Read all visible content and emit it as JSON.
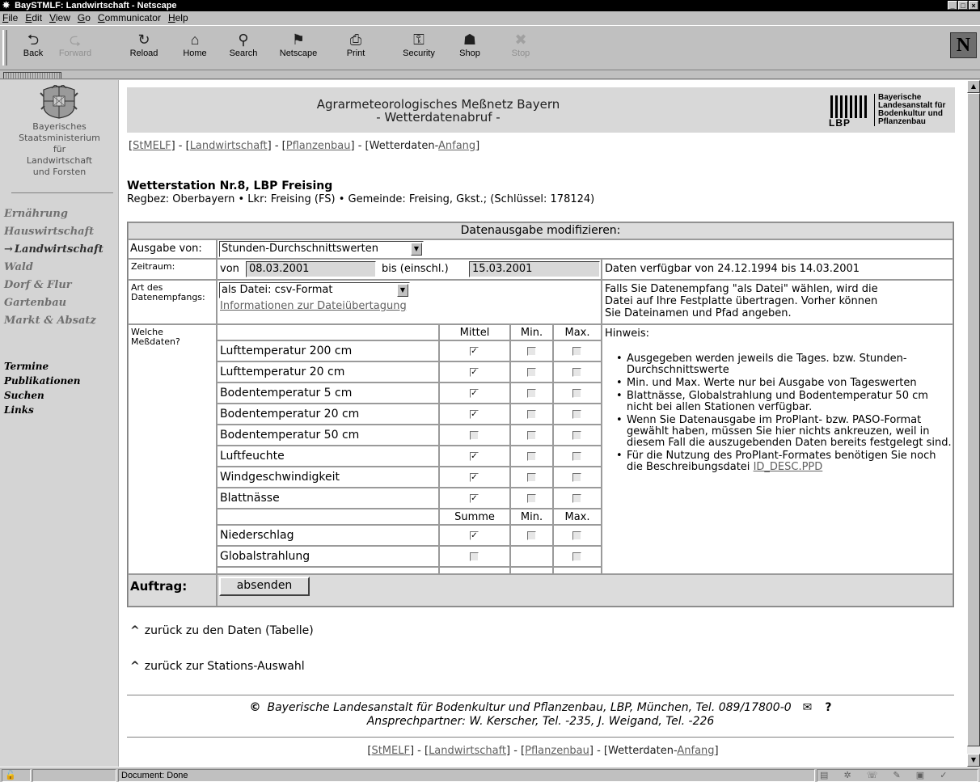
{
  "window": {
    "title": "BaySTMLF: Landwirtschaft - Netscape",
    "controls": [
      "_",
      "□",
      "×"
    ]
  },
  "menu": [
    "File",
    "Edit",
    "View",
    "Go",
    "Communicator",
    "Help"
  ],
  "toolbar": [
    {
      "label": "Back",
      "icon": "back-arrow-icon",
      "glyph": "⮌",
      "enabled": true
    },
    {
      "label": "Forward",
      "icon": "forward-arrow-icon",
      "glyph": "⮎",
      "enabled": false
    },
    {
      "label": "Reload",
      "icon": "reload-icon",
      "glyph": "↻",
      "enabled": true
    },
    {
      "label": "Home",
      "icon": "home-icon",
      "glyph": "⌂",
      "enabled": true
    },
    {
      "label": "Search",
      "icon": "search-icon",
      "glyph": "⚲",
      "enabled": true
    },
    {
      "label": "Netscape",
      "icon": "netscape-icon",
      "glyph": "⚑",
      "enabled": true
    },
    {
      "label": "Print",
      "icon": "print-icon",
      "glyph": "⎙",
      "enabled": true
    },
    {
      "label": "Security",
      "icon": "security-lock-icon",
      "glyph": "⚿",
      "enabled": true
    },
    {
      "label": "Shop",
      "icon": "shop-icon",
      "glyph": "☗",
      "enabled": true
    },
    {
      "label": "Stop",
      "icon": "stop-icon",
      "glyph": "✖",
      "enabled": false
    }
  ],
  "brand_logo": "N",
  "sidebar": {
    "ministry": "Bayerisches\nStaatsministerium\nfür\nLandwirtschaft\nund Forsten",
    "nav": [
      {
        "label": "Ernährung",
        "active": false
      },
      {
        "label": "Hauswirtschaft",
        "active": false
      },
      {
        "label": "Landwirtschaft",
        "active": true
      },
      {
        "label": "Wald",
        "active": false
      },
      {
        "label": "Dorf & Flur",
        "active": false
      },
      {
        "label": "Gartenbau",
        "active": false
      },
      {
        "label": "Markt & Absatz",
        "active": false
      }
    ],
    "nav2": [
      "Termine",
      "Publikationen",
      "Suchen",
      "Links"
    ]
  },
  "header": {
    "title1": "Agrarmeteorologisches Meßnetz Bayern",
    "title2": "- Wetterdatenabruf -",
    "lbp_abbr": "LBP",
    "lbp_name": "Bayerische\nLandesanstalt für\nBodenkultur und\nPflanzenbau"
  },
  "breadcrumb": {
    "stmelf": "StMELF",
    "landwirtschaft": "Landwirtschaft",
    "pflanzenbau": "Pflanzenbau",
    "wetter_prefix": "Wetterdaten-",
    "anfang": "Anfang"
  },
  "station": {
    "name": "Wetterstation Nr.8, LBP Freising",
    "location": "Regbez: Oberbayern • Lkr: Freising (FS) • Gemeinde: Freising, Gkst.; (Schlüssel: 178124)"
  },
  "form": {
    "heading": "Datenausgabe modifizieren:",
    "ausgabe_label": "Ausgabe von:",
    "ausgabe_value": "Stunden-Durchschnittswerten",
    "zeitraum_label": "Zeitraum:",
    "von_label": "von",
    "von_value": "08.03.2001",
    "bis_label": "bis (einschl.)",
    "bis_value": "15.03.2001",
    "verfuegbar": "Daten verfügbar von 24.12.1994 bis 14.03.2001",
    "art_label": "Art des\nDatenempfangs:",
    "art_value": "als Datei: csv-Format",
    "info_link": "Informationen zur Dateiübertagung",
    "art_hint": "Falls Sie Datenempfang \"als Datei\" wählen, wird die\nDatei auf Ihre Festplatte übertragen. Vorher können\nSie Dateinamen und Pfad angeben.",
    "welche_label": "Welche\nMeßdaten?",
    "col_mittel": "Mittel",
    "col_summe": "Summe",
    "col_min": "Min.",
    "col_max": "Max.",
    "rows": [
      {
        "name": "Lufttemperatur 200 cm",
        "a": true,
        "min": false,
        "max": false,
        "has_min": true
      },
      {
        "name": "Lufttemperatur 20 cm",
        "a": true,
        "min": false,
        "max": false,
        "has_min": true
      },
      {
        "name": "Bodentemperatur 5 cm",
        "a": true,
        "min": false,
        "max": false,
        "has_min": true
      },
      {
        "name": "Bodentemperatur 20 cm",
        "a": true,
        "min": false,
        "max": false,
        "has_min": true
      },
      {
        "name": "Bodentemperatur 50 cm",
        "a": false,
        "min": false,
        "max": false,
        "has_min": true
      },
      {
        "name": "Luftfeuchte",
        "a": true,
        "min": false,
        "max": false,
        "has_min": true
      },
      {
        "name": "Windgeschwindigkeit",
        "a": true,
        "min": false,
        "max": false,
        "has_min": true
      },
      {
        "name": "Blattnässe",
        "a": true,
        "min": false,
        "max": false,
        "has_min": true
      }
    ],
    "rows2": [
      {
        "name": "Niederschlag",
        "a": true,
        "min": false,
        "max": false,
        "has_min": true
      },
      {
        "name": "Globalstrahlung",
        "a": false,
        "min": false,
        "max": false,
        "has_min": false
      }
    ],
    "hinweis_title": "Hinweis:",
    "hinweis": [
      "Ausgegeben werden jeweils die Tages. bzw. Stunden-Durchschnittswerte",
      "Min. und Max. Werte nur bei Ausgabe von Tageswerten",
      "Blattnässe, Globalstrahlung und Bodentemperatur 50 cm nicht bei allen Stationen verfügbar.",
      "Wenn Sie Datenausgabe im ProPlant- bzw. PASO-Format gewählt haben, müssen Sie hier nichts ankreuzen, weil in diesem Fall die auszugebenden Daten bereits festgelegt sind."
    ],
    "hinweis_last": "Für die Nutzung des ProPlant-Formates benötigen Sie noch die Beschreibungsdatei",
    "hinweis_link": "ID_DESC.PPD",
    "auftrag_label": "Auftrag:",
    "submit": "absenden"
  },
  "links": {
    "back_data": "zurück zu den Daten (Tabelle)",
    "back_station": "zurück zur Stations-Auswahl"
  },
  "footer": {
    "line1": "Bayerische Landesanstalt für Bodenkultur und Pflanzenbau, LBP, München, Tel. 089/17800-0",
    "line2": "Ansprechpartner: W. Kerscher, Tel. -235, J. Weigand, Tel. -226"
  },
  "status": {
    "text": "Document: Done"
  }
}
